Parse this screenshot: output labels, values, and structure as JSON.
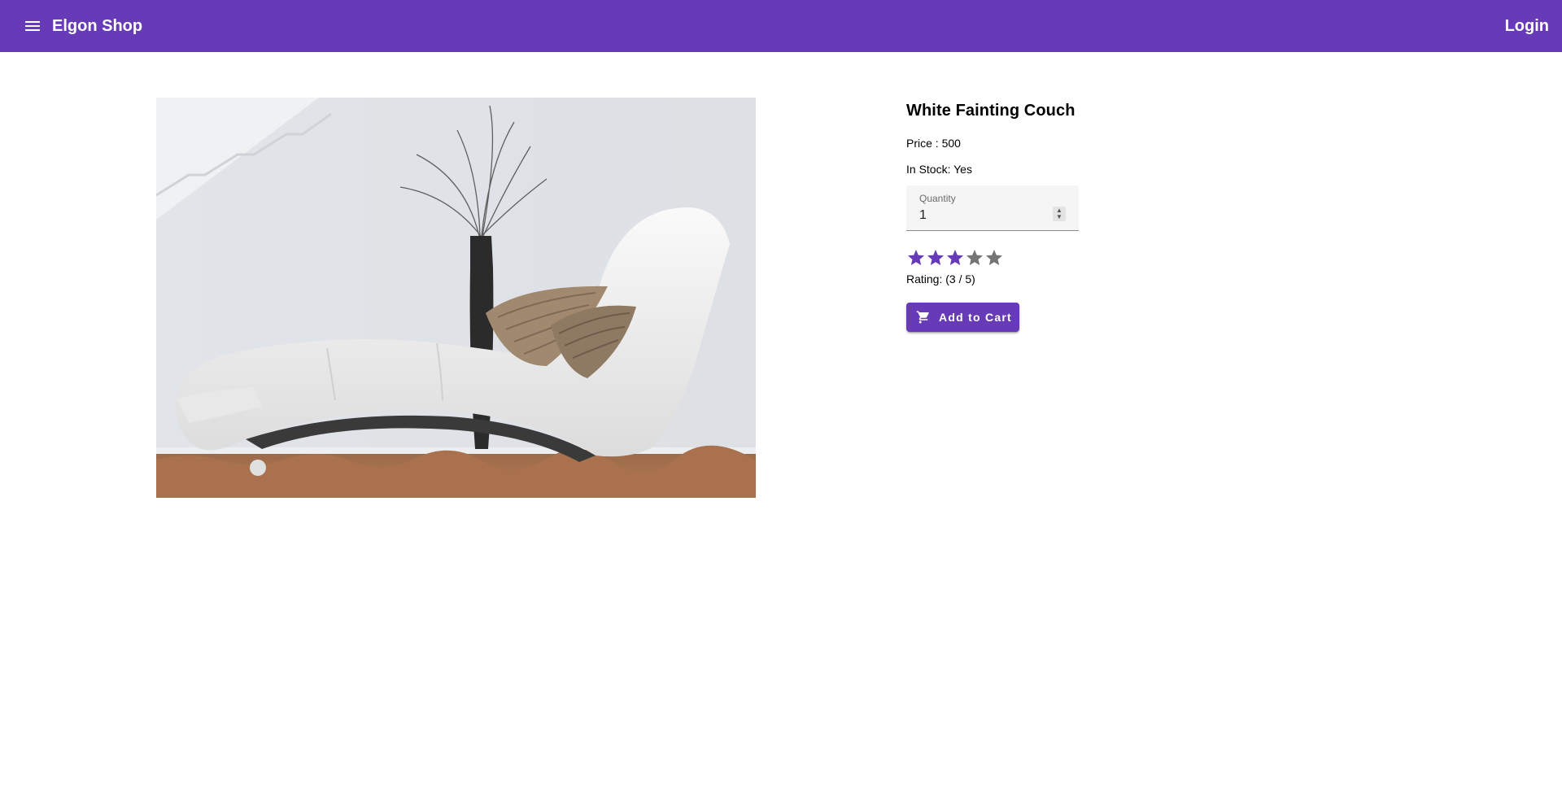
{
  "app": {
    "title": "Elgon Shop",
    "login_label": "Login",
    "accent": "#673ab7"
  },
  "header": {
    "menu_icon": "menu-icon"
  },
  "product": {
    "image_alt": "White fainting couch",
    "title": "White Fainting Couch",
    "price_text": "Price : 500",
    "stock_text": "In Stock: Yes",
    "quantity": {
      "label": "Quantity",
      "value": "1"
    },
    "rating": {
      "value": 3,
      "max": 5,
      "text": "Rating: (3 / 5)",
      "filled_color": "#673ab7",
      "empty_color": "#757575"
    },
    "add_to_cart": {
      "label": "Add to Cart",
      "icon": "cart-icon"
    }
  }
}
